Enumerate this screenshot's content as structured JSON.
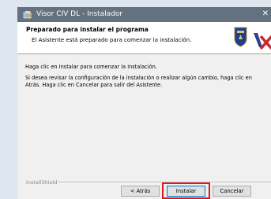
{
  "window": {
    "title": "Visor CIV DL - Instalador",
    "close_glyph": "✕"
  },
  "header": {
    "title": "Preparado para instalar el programa",
    "subtitle": "El Asistente está preparado para comenzar la instalación."
  },
  "content": {
    "line1": "Haga clic en Instalar para comenzar la instalación.",
    "line2": "Si desea revisar la configuración de la instalación o realizar algún cambio, haga clic en Atrás. Haga clic en Cancelar para salir del Asistente."
  },
  "footer": {
    "brand": "InstallShield"
  },
  "buttons": {
    "back": "< Atrás",
    "install": "Instalar",
    "cancel": "Cancelar"
  },
  "colors": {
    "titlebar": "#64717e",
    "highlight": "#e8141b",
    "logo_blue": "#2e3f8f",
    "logo_red": "#c8282c"
  },
  "icons": {
    "app": "installer-icon",
    "shield": "shield-emblem-icon",
    "logo": "vx-logo-icon"
  }
}
